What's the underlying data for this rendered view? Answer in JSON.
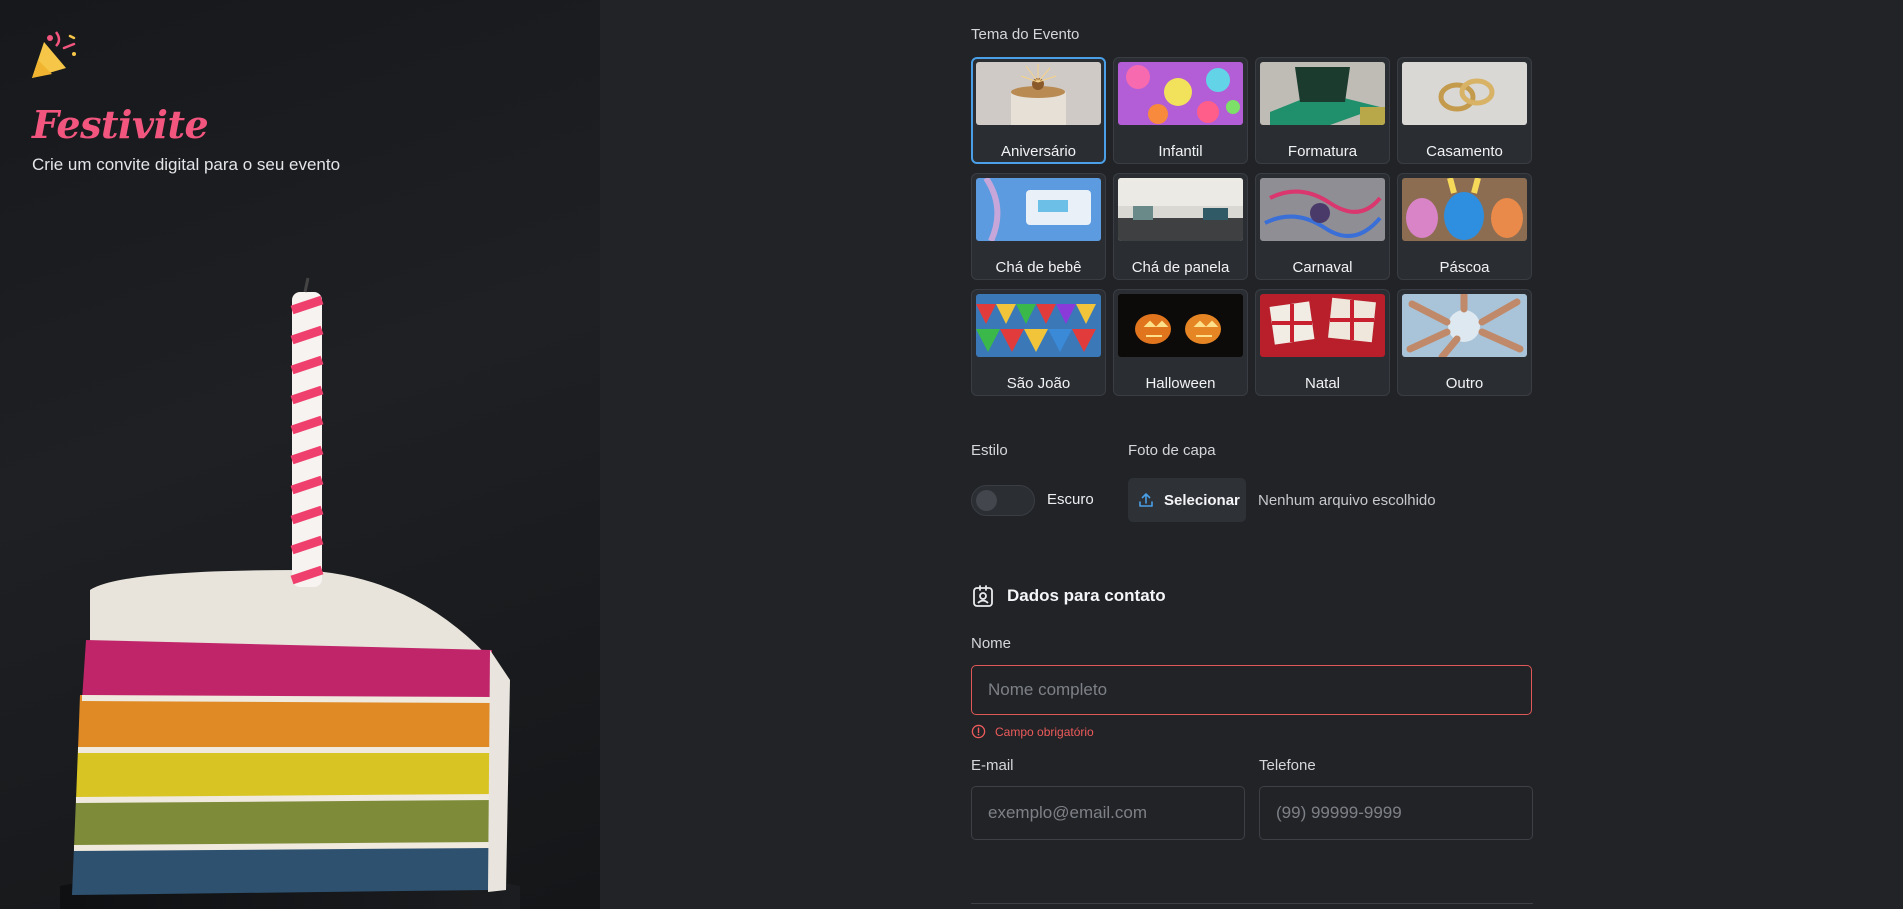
{
  "brand": {
    "name": "Festivite",
    "tagline": "Crie um convite digital para o seu evento"
  },
  "theme": {
    "label": "Tema do Evento",
    "options": [
      {
        "label": "Aniversário",
        "selected": true
      },
      {
        "label": "Infantil"
      },
      {
        "label": "Formatura"
      },
      {
        "label": "Casamento"
      },
      {
        "label": "Chá de bebê"
      },
      {
        "label": "Chá de panela"
      },
      {
        "label": "Carnaval"
      },
      {
        "label": "Páscoa"
      },
      {
        "label": "São João"
      },
      {
        "label": "Halloween"
      },
      {
        "label": "Natal"
      },
      {
        "label": "Outro"
      }
    ]
  },
  "style": {
    "label": "Estilo",
    "toggle_label": "Escuro",
    "enabled": false
  },
  "cover": {
    "label": "Foto de capa",
    "button_label": "Selecionar",
    "no_file_text": "Nenhum arquivo escolhido"
  },
  "contact": {
    "title": "Dados para contato",
    "name": {
      "label": "Nome",
      "placeholder": "Nome completo",
      "error": "Campo obrigatório"
    },
    "email": {
      "label": "E-mail",
      "placeholder": "exemplo@email.com"
    },
    "phone": {
      "label": "Telefone",
      "placeholder": "(99) 99999-9999"
    }
  },
  "colors": {
    "brand": "#f2557e",
    "selected_border": "#4a9fe6",
    "error": "#e05858",
    "background": "#212327"
  }
}
